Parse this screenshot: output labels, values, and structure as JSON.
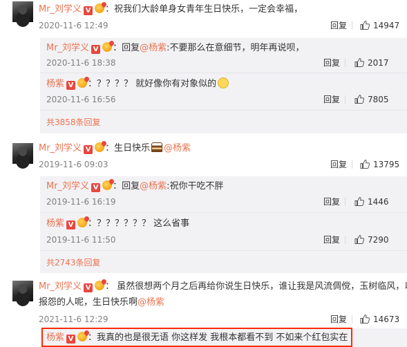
{
  "threads": [
    {
      "user": "Mr_刘学义",
      "text": "：祝我们大龄单身女青年生日快乐，一定会幸福，",
      "time": "2020-11-6 12:49",
      "reply_label": "回复",
      "likes": "14947",
      "replies": [
        {
          "user": "Mr_刘学义",
          "prefix": "：回复",
          "mention": "@杨紫",
          "text": ":不要那么在意细节，明年再说呗，",
          "time": "2020-11-6 18:38",
          "reply_label": "回复",
          "likes": "2017"
        },
        {
          "user": "杨紫",
          "prefix": "：？？？？ 就好像你有对象似的",
          "mention": "",
          "text": "",
          "time": "2020-11-6 16:56",
          "reply_label": "回复",
          "likes": "7805"
        }
      ],
      "more": "共3858条回复"
    },
    {
      "user": "Mr_刘学义",
      "text": "：生日快乐",
      "mention": "@杨紫",
      "time": "2019-11-6 09:03",
      "reply_label": "回复",
      "likes": "13795",
      "replies": [
        {
          "user": "Mr_刘学义",
          "prefix": "：回复",
          "mention": "@杨紫",
          "text": ":祝你干吃不胖",
          "time": "2019-11-6 16:19",
          "reply_label": "回复",
          "likes": "1446"
        },
        {
          "user": "杨紫",
          "prefix": "：？？？？？？ 这么省事",
          "mention": "",
          "text": "",
          "time": "2019-11-6 11:50",
          "reply_label": "回复",
          "likes": "7290"
        }
      ],
      "more": "共2743条回复"
    },
    {
      "user": "Mr_刘学义",
      "text_line1": "：  虽然很想两个月之后再给你说生日快乐，谁让我是风流倜傥，玉树临风，以德",
      "text_line2": "报怨的人呢，生日快乐啊",
      "mention": "@杨紫",
      "time": "2021-11-6 12:29",
      "reply_label": "回复",
      "likes": "14673",
      "replies": [
        {
          "user": "杨紫",
          "prefix": "：我真的也是很无语 你这样发 我根本都看不到 不如来个红包实在",
          "mention": "",
          "text": ""
        }
      ]
    }
  ],
  "badge_v": "V",
  "colors": {
    "username": "#eb7350",
    "highlight": "#ff2a00",
    "subbox": "#f2f2f5"
  }
}
